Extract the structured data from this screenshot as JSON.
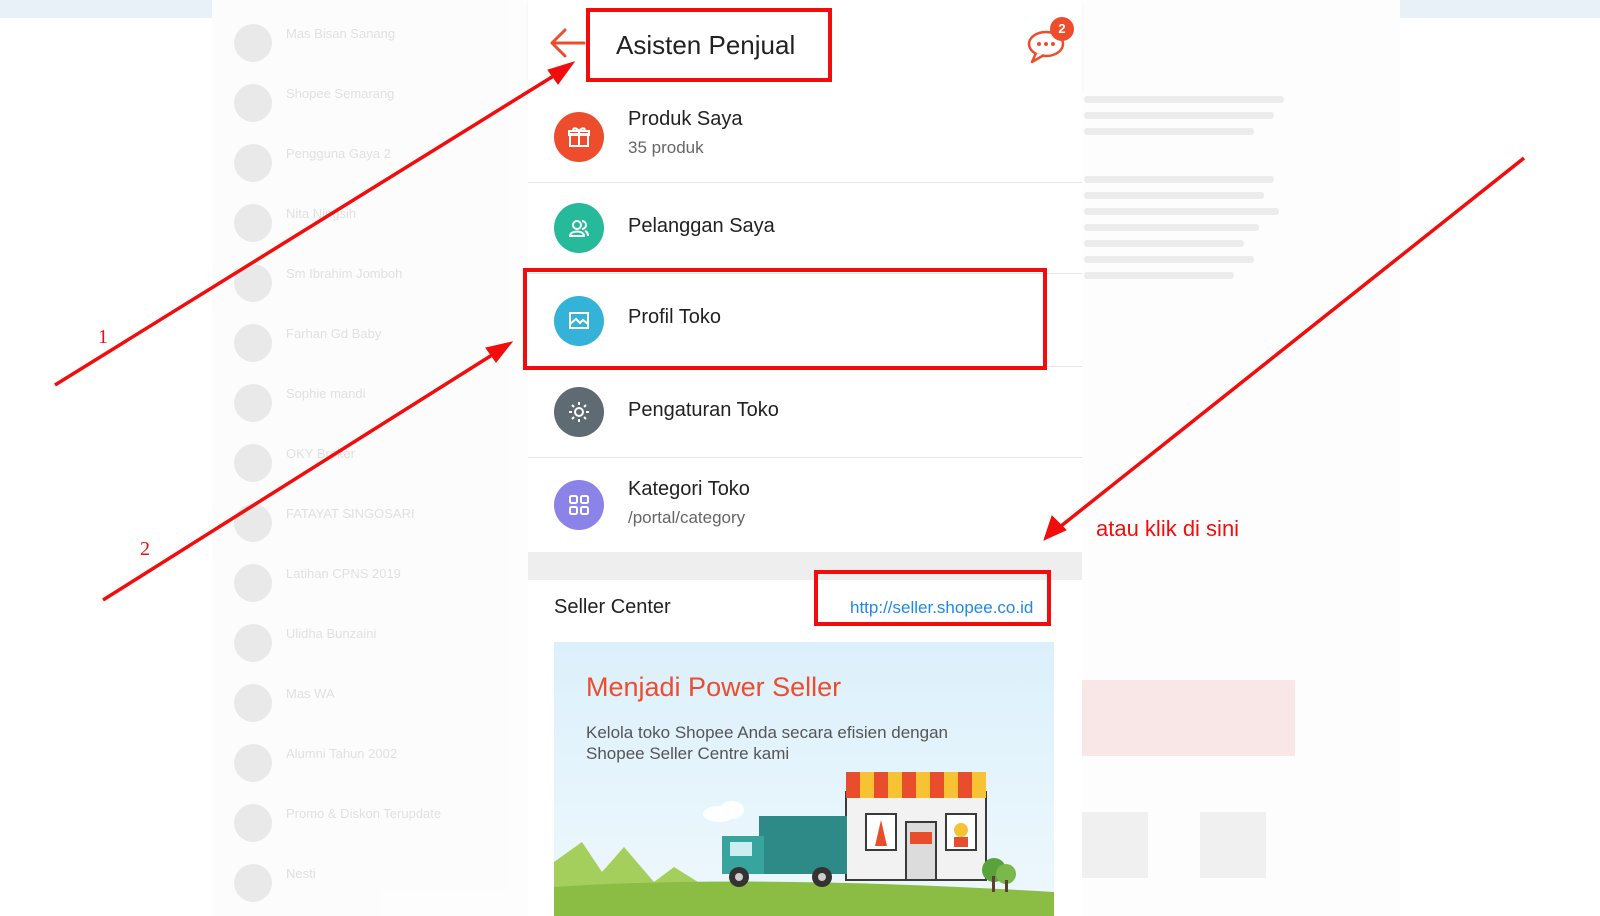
{
  "header": {
    "title": "Asisten Penjual",
    "chat_badge": "2"
  },
  "menu": {
    "items": [
      {
        "label": "Produk Saya",
        "sub": "35 produk",
        "icon": "gift-icon",
        "color": "#ee4d2d"
      },
      {
        "label": "Pelanggan Saya",
        "icon": "customers-icon",
        "color": "#26b99a"
      },
      {
        "label": "Profil Toko",
        "icon": "shop-profile-icon",
        "color": "#35b2d8"
      },
      {
        "label": "Pengaturan Toko",
        "icon": "gear-icon",
        "color": "#5f6b73"
      },
      {
        "label": "Kategori Toko",
        "sub": "/portal/category",
        "icon": "grid-icon",
        "color": "#8c83e8"
      }
    ]
  },
  "seller_center": {
    "label": "Seller Center",
    "link": "http://seller.shopee.co.id"
  },
  "banner": {
    "title": "Menjadi Power Seller",
    "desc": "Kelola toko Shopee Anda secara efisien dengan Shopee Seller Centre kami"
  },
  "annotations": {
    "step1": "1",
    "step2": "2",
    "alt_hint": "atau klik di sini",
    "color": "#f20d0d"
  },
  "background_chats": [
    "Mas Bisan Sanang",
    "Shopee Semarang",
    "Pengguna Gaya 2",
    "Nita Ningsih",
    "Sm Ibrahim Jomboh",
    "Farhan Gd Baby",
    "Sophie mandi",
    "OKY Broker",
    "FATAYAT SINGOSARI",
    "Latihan CPNS 2019",
    "Ulidha Bunzaini",
    "Mas WA",
    "Alumni Tahun 2002",
    "Promo & Diskon Terupdate",
    "Nesti"
  ]
}
